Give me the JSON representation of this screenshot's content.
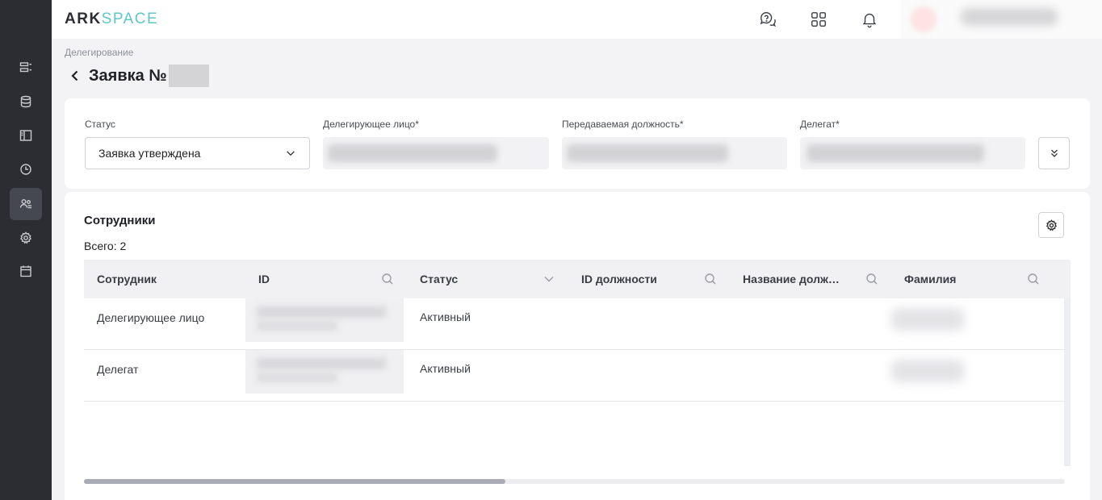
{
  "brand": {
    "part1": "ARK",
    "part2": "SPACE",
    "accent": "#5fc8c6"
  },
  "sidebar": {
    "items": [
      {
        "name": "list-icon",
        "active": false
      },
      {
        "name": "database-icon",
        "active": false
      },
      {
        "name": "panel-icon",
        "active": false
      },
      {
        "name": "clock-icon",
        "active": false
      },
      {
        "name": "users-icon",
        "active": true
      },
      {
        "name": "gear-icon",
        "active": false
      },
      {
        "name": "calendar-icon",
        "active": false
      }
    ]
  },
  "topbar": {
    "icons": [
      "help-chat-icon",
      "apps-grid-icon",
      "bell-icon"
    ]
  },
  "breadcrumb": "Делегирование",
  "page": {
    "title": "Заявка №"
  },
  "form": {
    "status": {
      "label": "Статус",
      "value": "Заявка утверждена"
    },
    "delegator": {
      "label": "Делегирующее лицо*"
    },
    "position": {
      "label": "Передаваемая должность*"
    },
    "delegate": {
      "label": "Делегат*"
    }
  },
  "employees": {
    "title": "Сотрудники",
    "total": "Всего: 2",
    "columns": [
      {
        "label": "Сотрудник",
        "icon": ""
      },
      {
        "label": "ID",
        "icon": "search-icon"
      },
      {
        "label": "Статус",
        "icon": "chevron-down-icon"
      },
      {
        "label": "ID должности",
        "icon": "search-icon"
      },
      {
        "label": "Название должности",
        "icon": "search-icon"
      },
      {
        "label": "Фамилия",
        "icon": "search-icon"
      }
    ],
    "rows": [
      {
        "employee": "Делегирующее лицо",
        "status": "Активный"
      },
      {
        "employee": "Делегат",
        "status": "Активный"
      }
    ],
    "scroll_fraction": 0.43
  }
}
